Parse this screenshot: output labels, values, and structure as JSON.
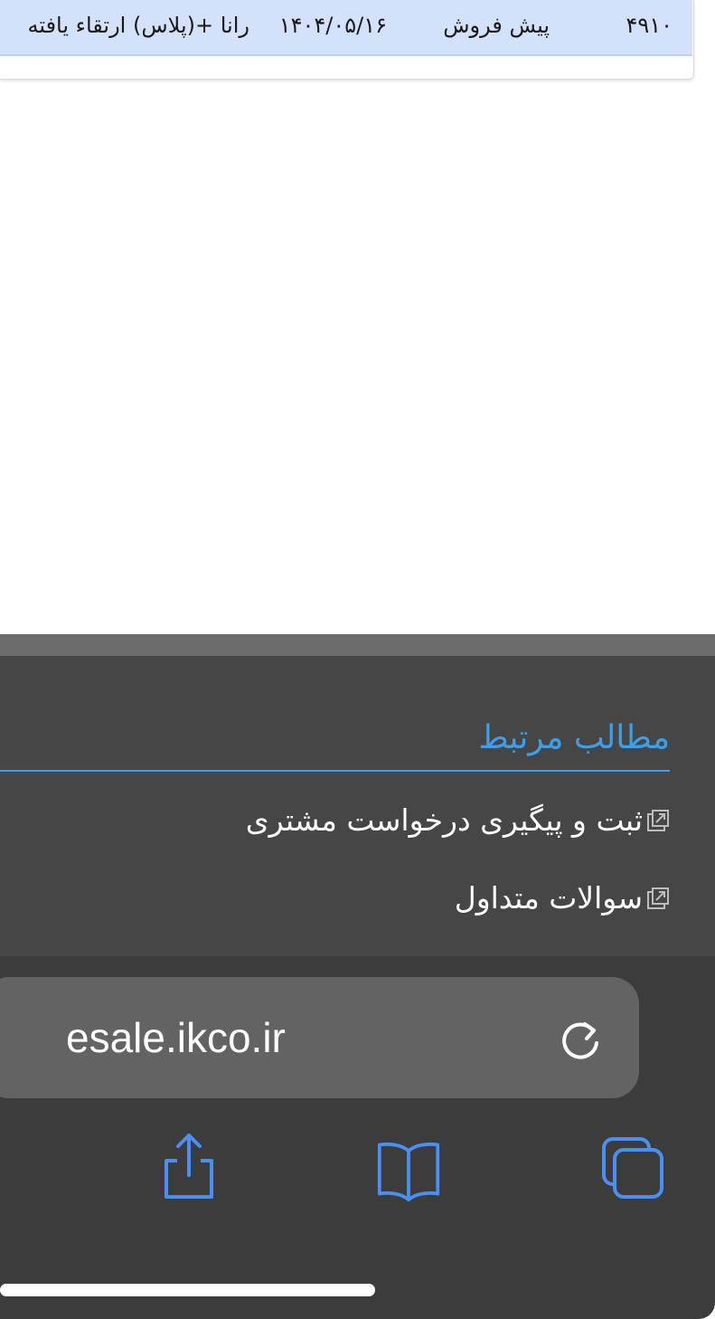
{
  "order_table": {
    "row": {
      "id": "۴۹۱۰",
      "status": "پیش فروش",
      "date": "۱۴۰۴/۰۵/۱۶",
      "product": "رانا +(پلاس) ارتقاء یافته"
    }
  },
  "related": {
    "title": "مطالب مرتبط",
    "links": [
      {
        "label": "ثبت و پیگیری درخواست مشتری",
        "icon": "external-link-icon"
      },
      {
        "label": "سوالات متداول",
        "icon": "external-link-icon"
      }
    ]
  },
  "browser": {
    "address": "esale.ikco.ir",
    "icons": {
      "reload": "reload-icon",
      "share": "share-icon",
      "bookmarks": "bookmarks-icon",
      "tabs": "tabs-icon"
    }
  },
  "colors": {
    "row_highlight": "#d4e1fb",
    "accent_blue": "#3f9ee8",
    "footer_bg": "#464646",
    "toolbar_bg": "#3c3c3c",
    "toolbar_icon": "#4a8ff5"
  }
}
